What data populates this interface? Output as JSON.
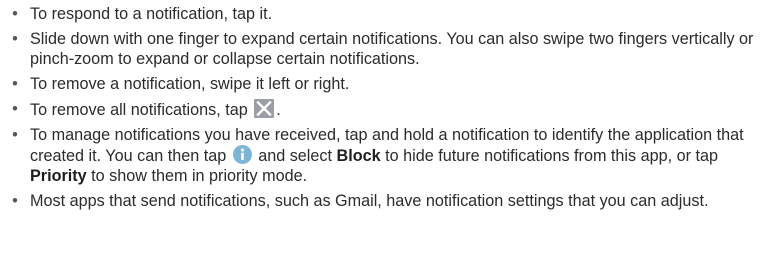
{
  "bullet_char": "•",
  "items": [
    {
      "text": "To respond to a notification, tap it."
    },
    {
      "text": "Slide down with one finger to expand certain notifications. You can also swipe two fingers vertically or pinch-zoom to expand or collapse certain notifications."
    },
    {
      "text": "To remove a notification, swipe it left or right."
    },
    {
      "before_icon": "To remove all notifications, tap ",
      "icon": "clear-all-icon",
      "after_icon": "."
    },
    {
      "part1": "To manage notifications you have received, tap and hold a notification to identify the application that created it. You can then tap ",
      "icon": "info-icon",
      "part2": " and select ",
      "bold1": "Block",
      "part3": " to hide future notifications from this app, or tap ",
      "bold2": "Priority",
      "part4": " to show them in priority mode."
    },
    {
      "text": "Most apps that send notifications, such as Gmail, have notification settings that you can adjust."
    }
  ],
  "colors": {
    "text": "#2b2b2b",
    "icon_bg": "#9a9fa6",
    "info_icon_bg": "#7bb6d8"
  }
}
